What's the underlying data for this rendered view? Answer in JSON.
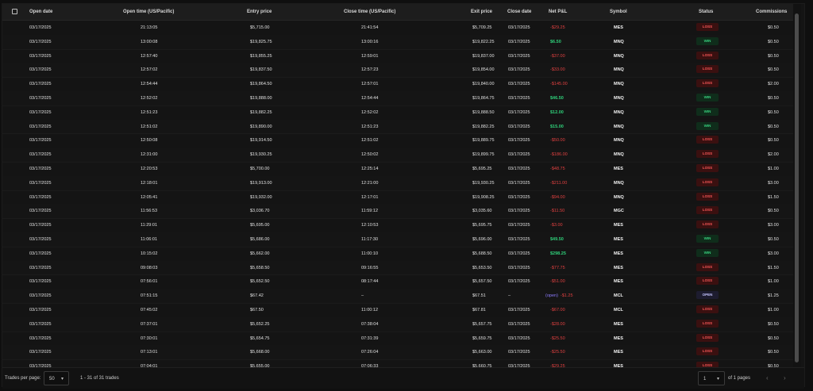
{
  "table": {
    "headers": {
      "open_date": "Open date",
      "open_time": "Open time (US/Pacific)",
      "entry_price": "Entry price",
      "close_time": "Close time (US/Pacific)",
      "exit_price": "Exit price",
      "close_date": "Close date",
      "net_pnl": "Net P&L",
      "symbol": "Symbol",
      "status": "Status",
      "commissions": "Commissions"
    },
    "rows": [
      {
        "open_date": "03/17/2025",
        "open_time": "21:13:05",
        "entry": "$5,715.00",
        "close_time": "21:41:54",
        "exit": "$5,709.25",
        "close_date": "03/17/2025",
        "pnl": "-$29.25",
        "pnl_type": "neg",
        "symbol": "MES",
        "status": "LOSS",
        "comm": "$0.50"
      },
      {
        "open_date": "03/17/2025",
        "open_time": "13:00:08",
        "entry": "$19,825.75",
        "close_time": "13:00:16",
        "exit": "$19,822.25",
        "close_date": "03/17/2025",
        "pnl": "$6.50",
        "pnl_type": "pos",
        "symbol": "MNQ",
        "status": "WIN",
        "comm": "$0.50"
      },
      {
        "open_date": "03/17/2025",
        "open_time": "12:57:40",
        "entry": "$19,855.25",
        "close_time": "12:59:01",
        "exit": "$19,837.00",
        "close_date": "03/17/2025",
        "pnl": "-$37.00",
        "pnl_type": "neg",
        "symbol": "MNQ",
        "status": "LOSS",
        "comm": "$0.50"
      },
      {
        "open_date": "03/17/2025",
        "open_time": "12:57:02",
        "entry": "$19,837.50",
        "close_time": "12:57:23",
        "exit": "$19,854.00",
        "close_date": "03/17/2025",
        "pnl": "-$33.00",
        "pnl_type": "neg",
        "symbol": "MNQ",
        "status": "LOSS",
        "comm": "$0.50"
      },
      {
        "open_date": "03/17/2025",
        "open_time": "12:54:44",
        "entry": "$19,864.50",
        "close_time": "12:57:01",
        "exit": "$19,840.00",
        "close_date": "03/17/2025",
        "pnl": "-$145.00",
        "pnl_type": "neg",
        "symbol": "MNQ",
        "status": "LOSS",
        "comm": "$2.00"
      },
      {
        "open_date": "03/17/2025",
        "open_time": "12:52:02",
        "entry": "$19,888.00",
        "close_time": "12:54:44",
        "exit": "$19,864.75",
        "close_date": "03/17/2025",
        "pnl": "$46.50",
        "pnl_type": "pos",
        "symbol": "MNQ",
        "status": "WIN",
        "comm": "$0.50"
      },
      {
        "open_date": "03/17/2025",
        "open_time": "12:51:23",
        "entry": "$19,882.25",
        "close_time": "12:52:02",
        "exit": "$19,888.50",
        "close_date": "03/17/2025",
        "pnl": "$12.00",
        "pnl_type": "pos",
        "symbol": "MNQ",
        "status": "WIN",
        "comm": "$0.50"
      },
      {
        "open_date": "03/17/2025",
        "open_time": "12:51:02",
        "entry": "$19,890.00",
        "close_time": "12:51:23",
        "exit": "$19,882.25",
        "close_date": "03/17/2025",
        "pnl": "$15.00",
        "pnl_type": "pos",
        "symbol": "MNQ",
        "status": "WIN",
        "comm": "$0.50"
      },
      {
        "open_date": "03/17/2025",
        "open_time": "12:50:08",
        "entry": "$19,914.50",
        "close_time": "12:51:02",
        "exit": "$19,889.75",
        "close_date": "03/17/2025",
        "pnl": "-$50.00",
        "pnl_type": "neg",
        "symbol": "MNQ",
        "status": "LOSS",
        "comm": "$0.50"
      },
      {
        "open_date": "03/17/2025",
        "open_time": "12:31:00",
        "entry": "$19,930.25",
        "close_time": "12:50:02",
        "exit": "$19,899.75",
        "close_date": "03/17/2025",
        "pnl": "-$186.00",
        "pnl_type": "neg",
        "symbol": "MNQ",
        "status": "LOSS",
        "comm": "$2.00"
      },
      {
        "open_date": "03/17/2025",
        "open_time": "12:20:53",
        "entry": "$5,700.00",
        "close_time": "12:25:14",
        "exit": "$5,695.25",
        "close_date": "03/17/2025",
        "pnl": "-$48.75",
        "pnl_type": "neg",
        "symbol": "MES",
        "status": "LOSS",
        "comm": "$1.00"
      },
      {
        "open_date": "03/17/2025",
        "open_time": "12:18:01",
        "entry": "$19,913.00",
        "close_time": "12:21:00",
        "exit": "$19,930.25",
        "close_date": "03/17/2025",
        "pnl": "-$211.00",
        "pnl_type": "neg",
        "symbol": "MNQ",
        "status": "LOSS",
        "comm": "$3.00"
      },
      {
        "open_date": "03/17/2025",
        "open_time": "12:05:41",
        "entry": "$19,932.00",
        "close_time": "12:17:01",
        "exit": "$19,908.25",
        "close_date": "03/17/2025",
        "pnl": "-$94.00",
        "pnl_type": "neg",
        "symbol": "MNQ",
        "status": "LOSS",
        "comm": "$1.50"
      },
      {
        "open_date": "03/17/2025",
        "open_time": "11:56:53",
        "entry": "$3,036.70",
        "close_time": "11:59:12",
        "exit": "$3,035.60",
        "close_date": "03/17/2025",
        "pnl": "-$11.50",
        "pnl_type": "neg",
        "symbol": "MGC",
        "status": "LOSS",
        "comm": "$0.50"
      },
      {
        "open_date": "03/17/2025",
        "open_time": "11:29:01",
        "entry": "$5,695.00",
        "close_time": "12:10:53",
        "exit": "$5,695.75",
        "close_date": "03/17/2025",
        "pnl": "-$3.00",
        "pnl_type": "neg",
        "symbol": "MES",
        "status": "LOSS",
        "comm": "$3.00"
      },
      {
        "open_date": "03/17/2025",
        "open_time": "11:06:01",
        "entry": "$5,686.00",
        "close_time": "11:17:30",
        "exit": "$5,696.00",
        "close_date": "03/17/2025",
        "pnl": "$49.50",
        "pnl_type": "pos",
        "symbol": "MES",
        "status": "WIN",
        "comm": "$0.50"
      },
      {
        "open_date": "03/17/2025",
        "open_time": "10:15:02",
        "entry": "$5,662.00",
        "close_time": "11:00:10",
        "exit": "$5,688.50",
        "close_date": "03/17/2025",
        "pnl": "$298.25",
        "pnl_type": "pos",
        "symbol": "MES",
        "status": "WIN",
        "comm": "$3.00"
      },
      {
        "open_date": "03/17/2025",
        "open_time": "09:08:03",
        "entry": "$5,658.50",
        "close_time": "09:16:55",
        "exit": "$5,653.50",
        "close_date": "03/17/2025",
        "pnl": "-$77.75",
        "pnl_type": "neg",
        "symbol": "MES",
        "status": "LOSS",
        "comm": "$1.50"
      },
      {
        "open_date": "03/17/2025",
        "open_time": "07:56:01",
        "entry": "$5,652.50",
        "close_time": "08:17:44",
        "exit": "$5,657.50",
        "close_date": "03/17/2025",
        "pnl": "-$51.00",
        "pnl_type": "neg",
        "symbol": "MES",
        "status": "LOSS",
        "comm": "$1.00"
      },
      {
        "open_date": "03/17/2025",
        "open_time": "07:51:15",
        "entry": "$67.42",
        "close_time": "–",
        "exit": "$67.51",
        "close_date": "–",
        "pnl": "-$1.25",
        "pnl_prefix": "(open)",
        "pnl_type": "open",
        "symbol": "MCL",
        "status": "OPEN",
        "comm": "$1.25"
      },
      {
        "open_date": "03/17/2025",
        "open_time": "07:45:02",
        "entry": "$67.50",
        "close_time": "11:00:12",
        "exit": "$67.81",
        "close_date": "03/17/2025",
        "pnl": "-$67.00",
        "pnl_type": "neg",
        "symbol": "MCL",
        "status": "LOSS",
        "comm": "$1.00"
      },
      {
        "open_date": "03/17/2025",
        "open_time": "07:37:01",
        "entry": "$5,652.25",
        "close_time": "07:38:04",
        "exit": "$5,657.75",
        "close_date": "03/17/2025",
        "pnl": "-$28.00",
        "pnl_type": "neg",
        "symbol": "MES",
        "status": "LOSS",
        "comm": "$0.50"
      },
      {
        "open_date": "03/17/2025",
        "open_time": "07:30:01",
        "entry": "$5,654.75",
        "close_time": "07:31:39",
        "exit": "$5,659.75",
        "close_date": "03/17/2025",
        "pnl": "-$25.50",
        "pnl_type": "neg",
        "symbol": "MES",
        "status": "LOSS",
        "comm": "$0.50"
      },
      {
        "open_date": "03/17/2025",
        "open_time": "07:13:01",
        "entry": "$5,668.00",
        "close_time": "07:26:04",
        "exit": "$5,663.00",
        "close_date": "03/17/2025",
        "pnl": "-$25.50",
        "pnl_type": "neg",
        "symbol": "MES",
        "status": "LOSS",
        "comm": "$0.50"
      },
      {
        "open_date": "03/17/2025",
        "open_time": "07:04:01",
        "entry": "$5,655.00",
        "close_time": "07:06:33",
        "exit": "$5,660.75",
        "close_date": "03/17/2025",
        "pnl": "-$29.25",
        "pnl_type": "neg",
        "symbol": "MES",
        "status": "LOSS",
        "comm": "$0.50"
      }
    ]
  },
  "footer": {
    "trades_per_page_label": "Trades per page:",
    "trades_per_page_value": "50",
    "range_text": "1 - 31 of 31 trades",
    "page_value": "1",
    "pages_text": "of 1 pages"
  },
  "colors": {
    "win": "#2fcf79",
    "loss": "#e04040",
    "open": "#8d7cff"
  }
}
